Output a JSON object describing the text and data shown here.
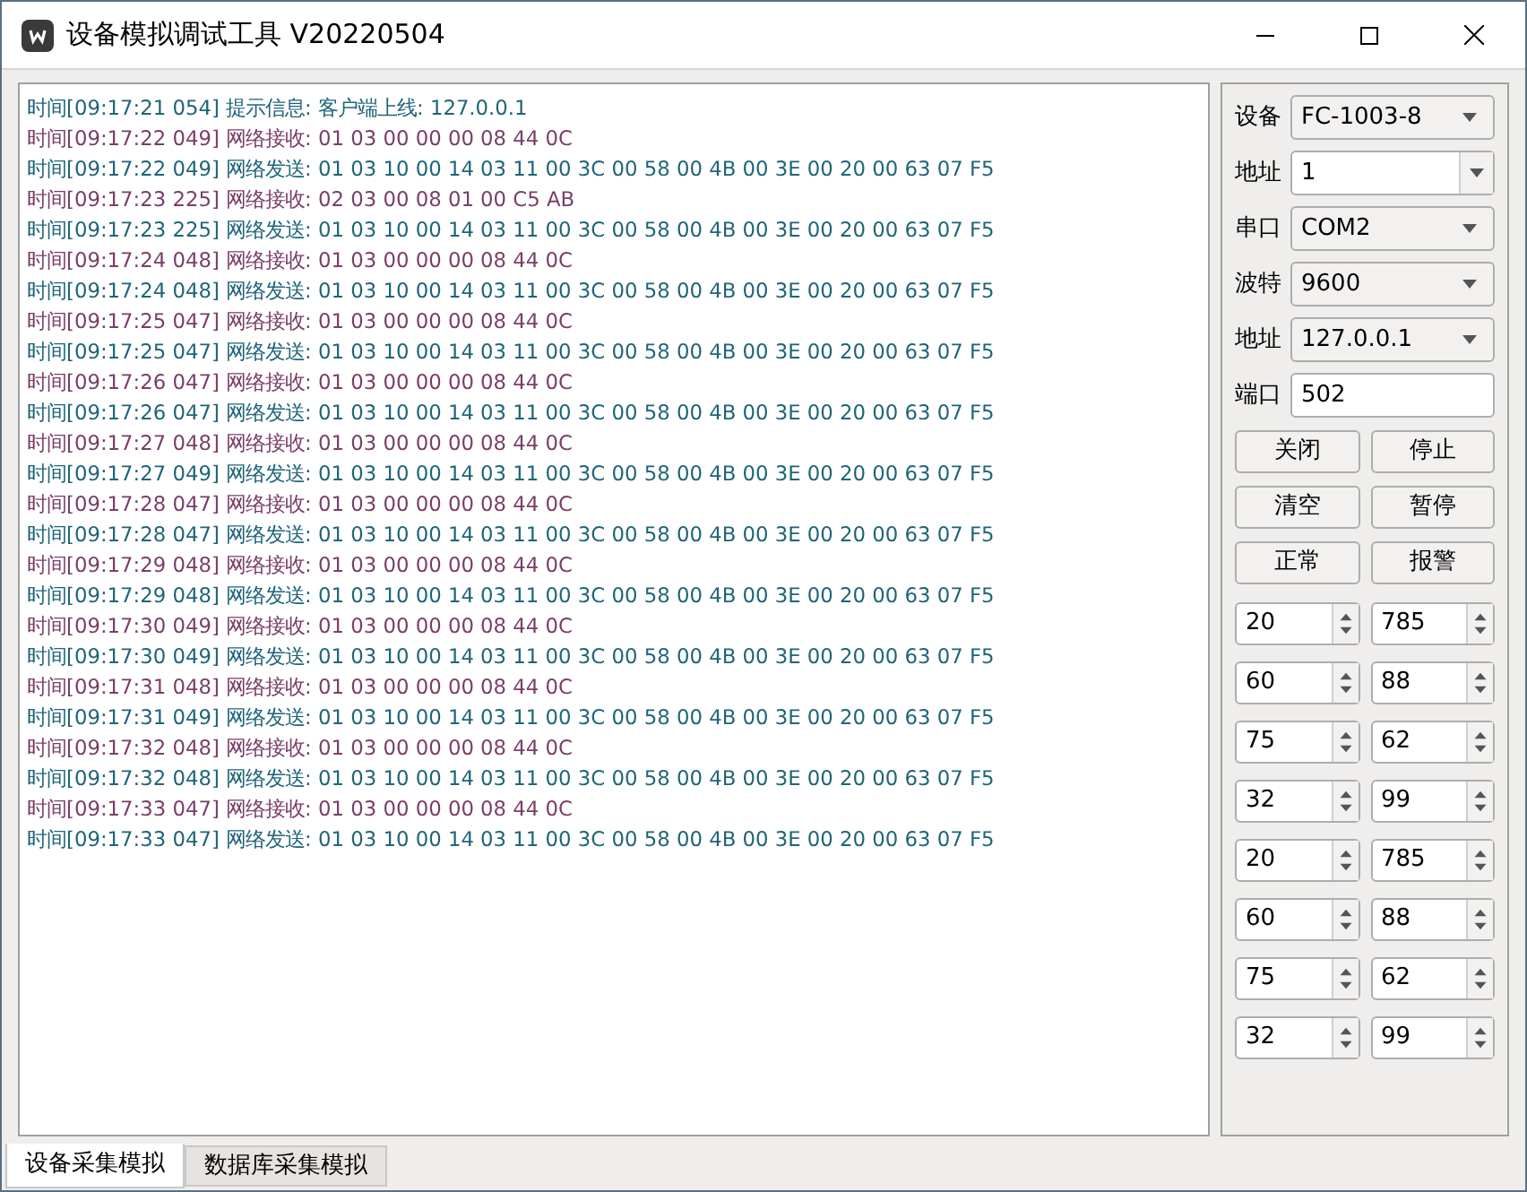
{
  "window": {
    "title": "设备模拟调试工具 V20220504"
  },
  "log": {
    "lines": [
      {
        "kind": "info",
        "text": "时间[09:17:21 054] 提示信息: 客户端上线: 127.0.0.1"
      },
      {
        "kind": "recv",
        "text": "时间[09:17:22 049] 网络接收: 01 03 00 00 00 08 44 0C"
      },
      {
        "kind": "send",
        "text": "时间[09:17:22 049] 网络发送: 01 03 10 00 14 03 11 00 3C 00 58 00 4B 00 3E 00 20 00 63 07 F5"
      },
      {
        "kind": "recv",
        "text": "时间[09:17:23 225] 网络接收: 02 03 00 08 01 00 C5 AB"
      },
      {
        "kind": "send",
        "text": "时间[09:17:23 225] 网络发送: 01 03 10 00 14 03 11 00 3C 00 58 00 4B 00 3E 00 20 00 63 07 F5"
      },
      {
        "kind": "recv",
        "text": "时间[09:17:24 048] 网络接收: 01 03 00 00 00 08 44 0C"
      },
      {
        "kind": "send",
        "text": "时间[09:17:24 048] 网络发送: 01 03 10 00 14 03 11 00 3C 00 58 00 4B 00 3E 00 20 00 63 07 F5"
      },
      {
        "kind": "recv",
        "text": "时间[09:17:25 047] 网络接收: 01 03 00 00 00 08 44 0C"
      },
      {
        "kind": "send",
        "text": "时间[09:17:25 047] 网络发送: 01 03 10 00 14 03 11 00 3C 00 58 00 4B 00 3E 00 20 00 63 07 F5"
      },
      {
        "kind": "recv",
        "text": "时间[09:17:26 047] 网络接收: 01 03 00 00 00 08 44 0C"
      },
      {
        "kind": "send",
        "text": "时间[09:17:26 047] 网络发送: 01 03 10 00 14 03 11 00 3C 00 58 00 4B 00 3E 00 20 00 63 07 F5"
      },
      {
        "kind": "recv",
        "text": "时间[09:17:27 048] 网络接收: 01 03 00 00 00 08 44 0C"
      },
      {
        "kind": "send",
        "text": "时间[09:17:27 049] 网络发送: 01 03 10 00 14 03 11 00 3C 00 58 00 4B 00 3E 00 20 00 63 07 F5"
      },
      {
        "kind": "recv",
        "text": "时间[09:17:28 047] 网络接收: 01 03 00 00 00 08 44 0C"
      },
      {
        "kind": "send",
        "text": "时间[09:17:28 047] 网络发送: 01 03 10 00 14 03 11 00 3C 00 58 00 4B 00 3E 00 20 00 63 07 F5"
      },
      {
        "kind": "recv",
        "text": "时间[09:17:29 048] 网络接收: 01 03 00 00 00 08 44 0C"
      },
      {
        "kind": "send",
        "text": "时间[09:17:29 048] 网络发送: 01 03 10 00 14 03 11 00 3C 00 58 00 4B 00 3E 00 20 00 63 07 F5"
      },
      {
        "kind": "recv",
        "text": "时间[09:17:30 049] 网络接收: 01 03 00 00 00 08 44 0C"
      },
      {
        "kind": "send",
        "text": "时间[09:17:30 049] 网络发送: 01 03 10 00 14 03 11 00 3C 00 58 00 4B 00 3E 00 20 00 63 07 F5"
      },
      {
        "kind": "recv",
        "text": "时间[09:17:31 048] 网络接收: 01 03 00 00 00 08 44 0C"
      },
      {
        "kind": "send",
        "text": "时间[09:17:31 049] 网络发送: 01 03 10 00 14 03 11 00 3C 00 58 00 4B 00 3E 00 20 00 63 07 F5"
      },
      {
        "kind": "recv",
        "text": "时间[09:17:32 048] 网络接收: 01 03 00 00 00 08 44 0C"
      },
      {
        "kind": "send",
        "text": "时间[09:17:32 048] 网络发送: 01 03 10 00 14 03 11 00 3C 00 58 00 4B 00 3E 00 20 00 63 07 F5"
      },
      {
        "kind": "recv",
        "text": "时间[09:17:33 047] 网络接收: 01 03 00 00 00 08 44 0C"
      },
      {
        "kind": "send",
        "text": "时间[09:17:33 047] 网络发送: 01 03 10 00 14 03 11 00 3C 00 58 00 4B 00 3E 00 20 00 63 07 F5"
      }
    ]
  },
  "settings": [
    {
      "kind": "combo",
      "label": "设备",
      "value": "FC-1003-8"
    },
    {
      "kind": "editable_combo",
      "label": "地址",
      "value": "1"
    },
    {
      "kind": "combo",
      "label": "串口",
      "value": "COM2"
    },
    {
      "kind": "combo",
      "label": "波特",
      "value": "9600"
    },
    {
      "kind": "combo",
      "label": "地址",
      "value": "127.0.0.1"
    },
    {
      "kind": "field",
      "label": "端口",
      "value": "502"
    }
  ],
  "buttons": [
    "关闭",
    "停止",
    "清空",
    "暂停",
    "正常",
    "报警"
  ],
  "spinners": [
    "20",
    "785",
    "60",
    "88",
    "75",
    "62",
    "32",
    "99",
    "20",
    "785",
    "60",
    "88",
    "75",
    "62",
    "32",
    "99"
  ],
  "tabs": [
    {
      "label": "设备采集模拟",
      "selected": true
    },
    {
      "label": "数据库采集模拟",
      "selected": false
    }
  ]
}
